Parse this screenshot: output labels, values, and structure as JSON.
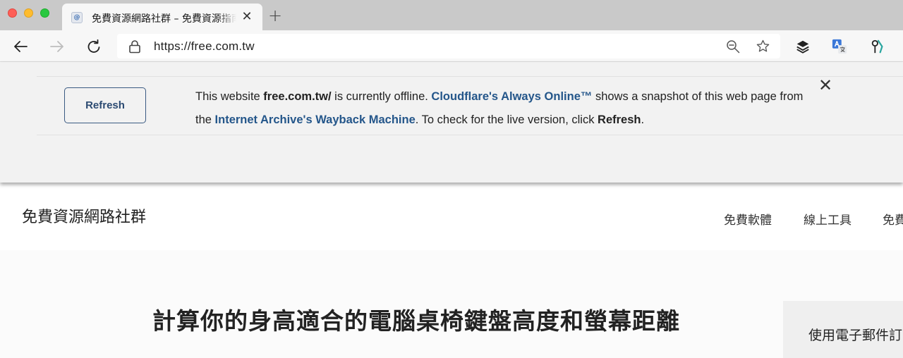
{
  "browser": {
    "tab": {
      "title": "免費資源網路社群 – 免費資源指南",
      "close_icon": "✕",
      "favicon": "site-favicon"
    },
    "new_tab_label": "+",
    "address": {
      "url": "https://free.com.tw"
    },
    "toolbar_icons": [
      "back-arrow-icon",
      "forward-arrow-icon",
      "reload-icon",
      "lock-icon",
      "zoom-icon",
      "star-icon",
      "layers-icon",
      "translate-icon",
      "extension-icon"
    ]
  },
  "banner": {
    "refresh_label": "Refresh",
    "text_prefix": "This website ",
    "site": "free.com.tw/",
    "text_mid1": " is currently offline. ",
    "always_online": "Cloudflare's Always Online™",
    "text_mid2": " shows a snapshot of this web page from the ",
    "wayback": "Internet Archive's Wayback Machine",
    "text_mid3": ". To check for the live version, click ",
    "refresh_word": "Refresh",
    "text_end": ".",
    "close_label": "✕"
  },
  "site": {
    "title": "免費資源網路社群",
    "nav": [
      "免費軟體",
      "線上工具",
      "免費"
    ]
  },
  "main": {
    "post_title": "計算你的身高適合的電腦桌椅鍵盤高度和螢幕距離"
  },
  "sidebar": {
    "heading": "使用電子郵件訂閱"
  },
  "colors": {
    "link": "#24568a",
    "button_border": "#3a5a82"
  }
}
